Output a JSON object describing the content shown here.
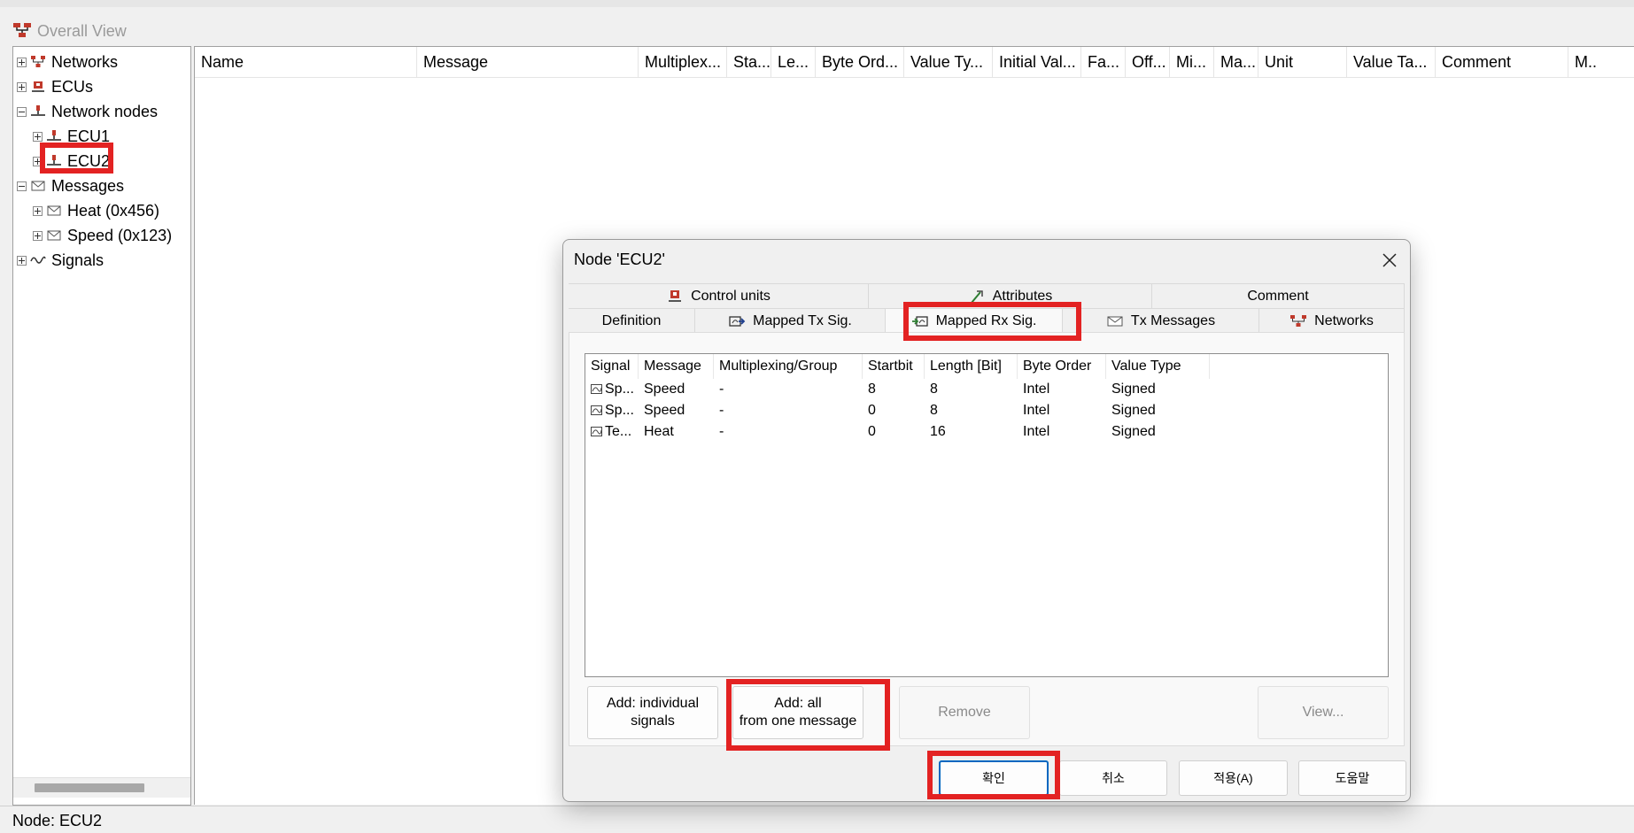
{
  "window": {
    "title": "Overall View"
  },
  "tree": {
    "items": [
      {
        "label": "Networks"
      },
      {
        "label": "ECUs"
      },
      {
        "label": "Network nodes"
      },
      {
        "label": "ECU1"
      },
      {
        "label": "ECU2"
      },
      {
        "label": "Messages"
      },
      {
        "label": "Heat (0x456)"
      },
      {
        "label": "Speed (0x123)"
      },
      {
        "label": "Signals"
      }
    ]
  },
  "main": {
    "columns": [
      "Name",
      "Message",
      "Multiplex...",
      "Sta...",
      "Le...",
      "Byte Ord...",
      "Value Ty...",
      "Initial Val...",
      "Fa...",
      "Off...",
      "Mi...",
      "Ma...",
      "Unit",
      "Value Ta...",
      "Comment",
      "M.."
    ]
  },
  "statusbar": {
    "text": "Node: ECU2"
  },
  "dialog": {
    "title": "Node 'ECU2'",
    "tabs_top": [
      "Control units",
      "Attributes",
      "Comment"
    ],
    "tabs_bottom": [
      "Definition",
      "Mapped Tx Sig.",
      "Mapped Rx Sig.",
      "Tx Messages",
      "Networks"
    ],
    "list": {
      "columns": [
        "Signal",
        "Message",
        "Multiplexing/Group",
        "Startbit",
        "Length [Bit]",
        "Byte Order",
        "Value Type"
      ],
      "rows": [
        [
          "Sp...",
          "Speed",
          "-",
          "8",
          "8",
          "Intel",
          "Signed"
        ],
        [
          "Sp...",
          "Speed",
          "-",
          "0",
          "8",
          "Intel",
          "Signed"
        ],
        [
          "Te...",
          "Heat",
          "-",
          "0",
          "16",
          "Intel",
          "Signed"
        ]
      ]
    },
    "buttons": {
      "add_individual_line1": "Add: individual",
      "add_individual_line2": "signals",
      "add_all_line1": "Add: all",
      "add_all_line2": "from one message",
      "remove": "Remove",
      "view": "View...",
      "ok": "확인",
      "cancel": "취소",
      "apply": "적용(A)",
      "help": "도움말"
    }
  },
  "colors": {
    "highlight": "#e32222",
    "primary_border": "#0067c0"
  }
}
